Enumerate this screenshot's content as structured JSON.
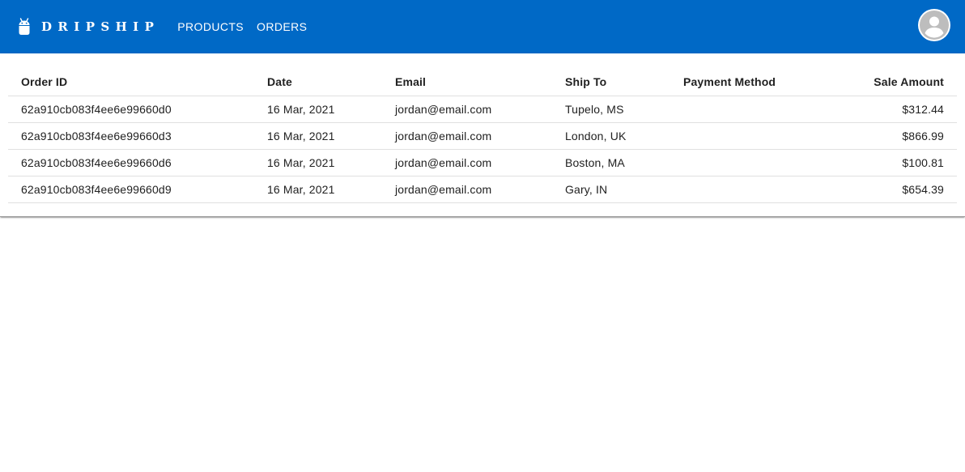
{
  "app": {
    "brand": "DRIPSHIP",
    "brand_icon": "android-robot-icon",
    "accent_color": "#0069c6"
  },
  "nav": {
    "products_label": "PRODUCTS",
    "orders_label": "ORDERS"
  },
  "account": {
    "icon": "account-circle-icon"
  },
  "orders_table": {
    "columns": [
      "Order ID",
      "Date",
      "Email",
      "Ship To",
      "Payment Method",
      "Sale Amount"
    ],
    "rows": [
      {
        "order_id": "62a910cb083f4ee6e99660d0",
        "date": "16 Mar, 2021",
        "email": "jordan@email.com",
        "ship_to": "Tupelo, MS",
        "payment_method": "",
        "sale_amount": "$312.44"
      },
      {
        "order_id": "62a910cb083f4ee6e99660d3",
        "date": "16 Mar, 2021",
        "email": "jordan@email.com",
        "ship_to": "London, UK",
        "payment_method": "",
        "sale_amount": "$866.99"
      },
      {
        "order_id": "62a910cb083f4ee6e99660d6",
        "date": "16 Mar, 2021",
        "email": "jordan@email.com",
        "ship_to": "Boston, MA",
        "payment_method": "",
        "sale_amount": "$100.81"
      },
      {
        "order_id": "62a910cb083f4ee6e99660d9",
        "date": "16 Mar, 2021",
        "email": "jordan@email.com",
        "ship_to": "Gary, IN",
        "payment_method": "",
        "sale_amount": "$654.39"
      }
    ]
  }
}
